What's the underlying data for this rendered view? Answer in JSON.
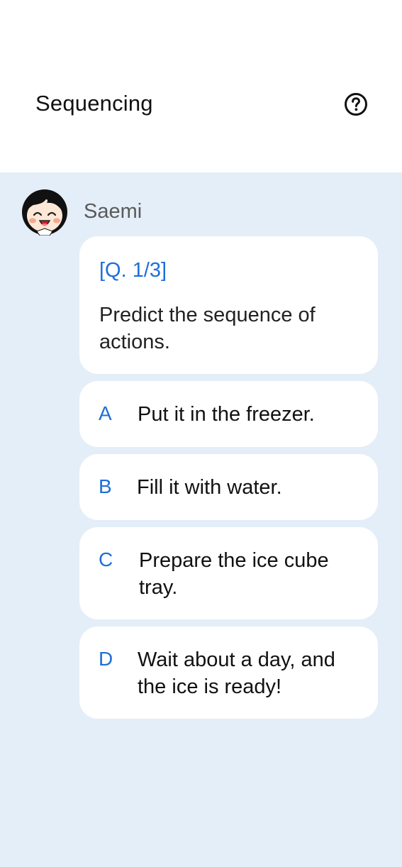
{
  "header": {
    "title": "Sequencing",
    "help_icon": "question-circle-icon"
  },
  "chat": {
    "sender": "Saemi",
    "avatar_icon": "smiling-child-avatar",
    "question": {
      "number": "[Q. 1/3]",
      "text": "Predict the sequence of actions."
    },
    "options": [
      {
        "letter": "A",
        "text": "Put it in the freezer."
      },
      {
        "letter": "B",
        "text": "Fill it with water."
      },
      {
        "letter": "C",
        "text": "Prepare the ice cube tray."
      },
      {
        "letter": "D",
        "text": "Wait about a day, and the ice is ready!"
      }
    ]
  },
  "colors": {
    "accent": "#1e6fd9",
    "chat_background": "#e4eef8",
    "bubble": "#ffffff"
  }
}
